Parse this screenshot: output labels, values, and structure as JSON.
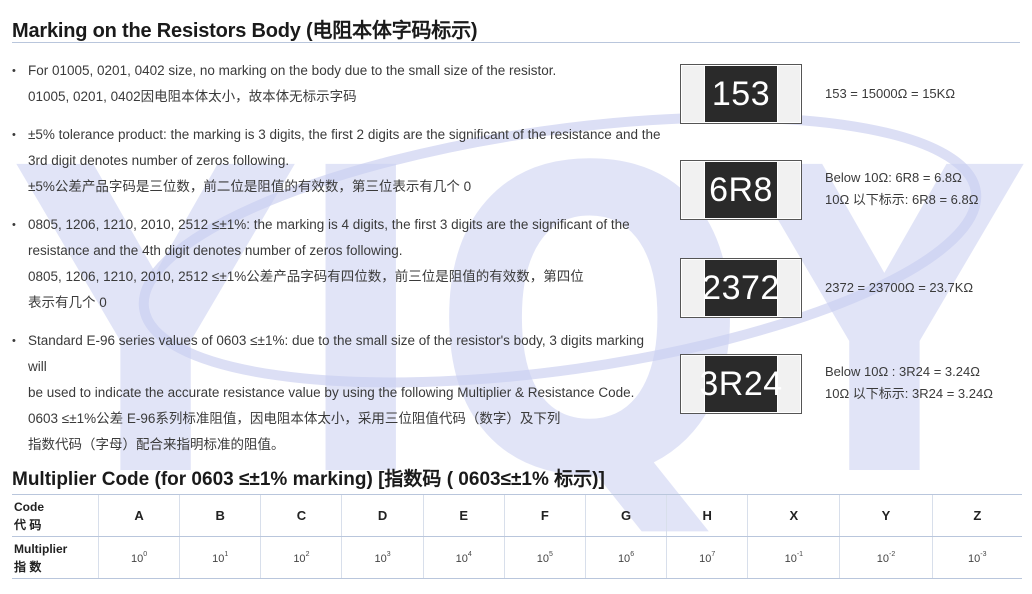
{
  "section_title": "Marking on the Resistors Body (电阻本体字码标示)",
  "bullets": [
    {
      "lines": [
        "For 01005, 0201, 0402 size, no marking on the body due to the small size of the resistor.",
        "01005, 0201, 0402因电阻本体太小，故本体无标示字码"
      ]
    },
    {
      "lines": [
        "±5% tolerance product: the marking is 3 digits, the first 2 digits are the significant of the resistance and the",
        "3rd digit denotes number of zeros following.",
        "±5%公差产品字码是三位数，前二位是阻值的有效数，第三位表示有几个 0"
      ]
    },
    {
      "lines": [
        "0805, 1206, 1210, 2010, 2512 ≤±1%: the marking is 4 digits, the first 3 digits are the significant of the",
        "resistance and the 4th digit denotes number of zeros following.",
        "0805, 1206, 1210, 2010, 2512 ≤±1%公差产品字码有四位数，前三位是阻值的有效数，第四位",
        "表示有几个 0"
      ]
    },
    {
      "lines": [
        "Standard E-96 series values of 0603 ≤±1%: due to the small size of the resistor's body, 3 digits marking will",
        "be used to indicate the accurate resistance value by using the following Multiplier & Resistance Code.",
        "0603 ≤±1%公差 E-96系列标准阻值，因电阻本体太小，采用三位阻值代码（数字）及下列",
        "指数代码（字母）配合来指明标准的阻值。"
      ]
    }
  ],
  "chips": [
    {
      "code": "153",
      "desc": [
        "153 = 15000Ω = 15KΩ"
      ]
    },
    {
      "code": "6R8",
      "desc": [
        "Below 10Ω: 6R8 = 6.8Ω",
        "10Ω 以下标示: 6R8 = 6.8Ω"
      ]
    },
    {
      "code": "2372",
      "desc": [
        "2372 = 23700Ω = 23.7KΩ"
      ]
    },
    {
      "code": "3R24",
      "desc": [
        "Below 10Ω : 3R24 = 3.24Ω",
        "10Ω 以下标示: 3R24 = 3.24Ω"
      ]
    }
  ],
  "multiplier_title": "Multiplier Code (for 0603 ≤±1% marking) [指数码 ( 0603≤±1% 标示)]",
  "table": {
    "code_header": [
      "Code",
      "代  码"
    ],
    "multiplier_header": [
      "Multiplier",
      "指  数"
    ],
    "codes": [
      "A",
      "B",
      "C",
      "D",
      "E",
      "F",
      "G",
      "H",
      "X",
      "Y",
      "Z"
    ],
    "multipliers": [
      {
        "base": "10",
        "exp": "0"
      },
      {
        "base": "10",
        "exp": "1"
      },
      {
        "base": "10",
        "exp": "2"
      },
      {
        "base": "10",
        "exp": "3"
      },
      {
        "base": "10",
        "exp": "4"
      },
      {
        "base": "10",
        "exp": "5"
      },
      {
        "base": "10",
        "exp": "6"
      },
      {
        "base": "10",
        "exp": "7"
      },
      {
        "base": "10",
        "exp": "-1"
      },
      {
        "base": "10",
        "exp": "-2"
      },
      {
        "base": "10",
        "exp": "-3"
      }
    ]
  },
  "watermark": {
    "text": "YIQY",
    "color": "#c9cdf0"
  },
  "colors": {
    "rule": "#b9c6dc",
    "chip_body": "#2a2a2a"
  }
}
